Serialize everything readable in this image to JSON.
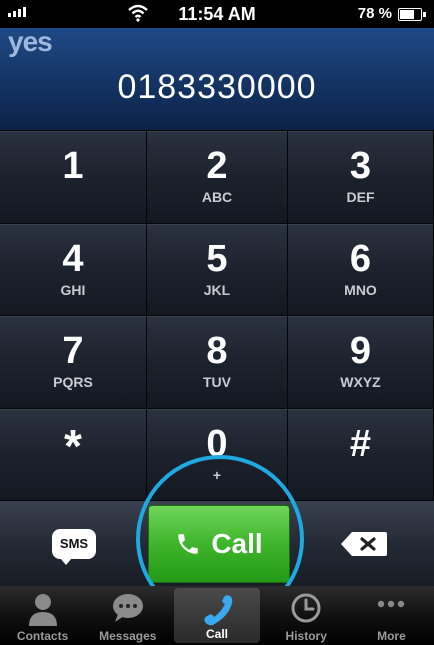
{
  "status_bar": {
    "time": "11:54 AM",
    "battery": "78 %",
    "battery_level": 0.78
  },
  "display": {
    "carrier": "yes",
    "number": "0183330000"
  },
  "keypad": [
    {
      "digit": "1",
      "letters": ""
    },
    {
      "digit": "2",
      "letters": "ABC"
    },
    {
      "digit": "3",
      "letters": "DEF"
    },
    {
      "digit": "4",
      "letters": "GHI"
    },
    {
      "digit": "5",
      "letters": "JKL"
    },
    {
      "digit": "6",
      "letters": "MNO"
    },
    {
      "digit": "7",
      "letters": "PQRS"
    },
    {
      "digit": "8",
      "letters": "TUV"
    },
    {
      "digit": "9",
      "letters": "WXYZ"
    },
    {
      "digit": "*",
      "letters": ""
    },
    {
      "digit": "0",
      "letters": "+"
    },
    {
      "digit": "#",
      "letters": ""
    }
  ],
  "actions": {
    "sms_label": "SMS",
    "call_label": "Call",
    "call_color": "#3fb42c",
    "highlight_color": "#1fa9e0"
  },
  "tabs": [
    {
      "label": "Contacts",
      "icon": "contacts-icon"
    },
    {
      "label": "Messages",
      "icon": "messages-icon"
    },
    {
      "label": "Call",
      "icon": "call-icon",
      "active": true
    },
    {
      "label": "History",
      "icon": "history-icon"
    },
    {
      "label": "More",
      "icon": "more-icon"
    }
  ]
}
